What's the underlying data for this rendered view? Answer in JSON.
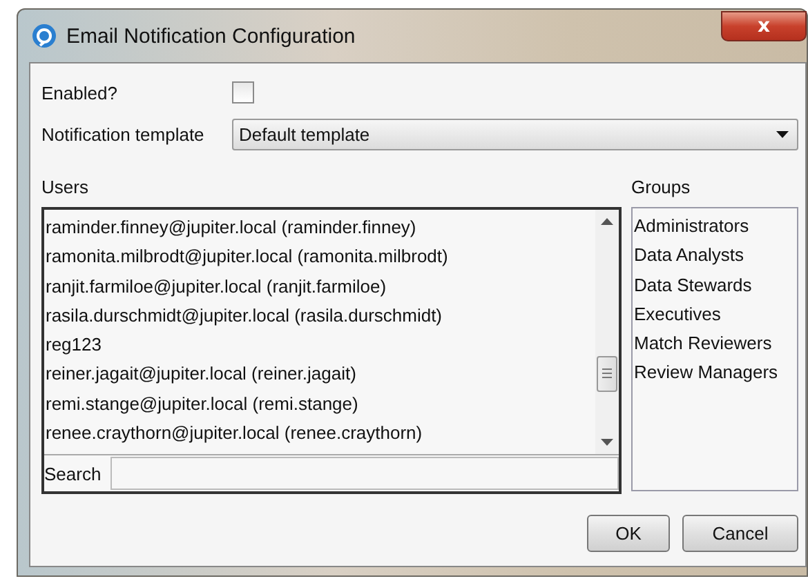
{
  "window": {
    "title": "Email Notification Configuration",
    "close": "x"
  },
  "enabled": {
    "label": "Enabled?",
    "checked": false
  },
  "template": {
    "label": "Notification template",
    "value": "Default template"
  },
  "users": {
    "label": "Users",
    "items": [
      "raminder.finney@jupiter.local (raminder.finney)",
      "ramonita.milbrodt@jupiter.local (ramonita.milbrodt)",
      "ranjit.farmiloe@jupiter.local (ranjit.farmiloe)",
      "rasila.durschmidt@jupiter.local (rasila.durschmidt)",
      "reg123",
      "reiner.jagait@jupiter.local (reiner.jagait)",
      "remi.stange@jupiter.local (remi.stange)",
      "renee.craythorn@jupiter.local (renee.craythorn)"
    ],
    "search_label": "Search"
  },
  "groups": {
    "label": "Groups",
    "items": [
      "Administrators",
      "Data Analysts",
      "Data Stewards",
      "Executives",
      "Match Reviewers",
      "Review Managers"
    ]
  },
  "buttons": [
    "OK",
    "Cancel"
  ]
}
